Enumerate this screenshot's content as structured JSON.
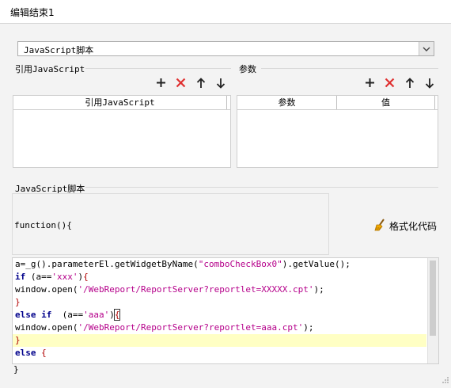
{
  "window": {
    "title": "编辑结束1"
  },
  "script_type": {
    "selected": "JavaScript脚本"
  },
  "ref_section": {
    "label": "引用JavaScript",
    "columns": [
      "引用JavaScript"
    ]
  },
  "param_section": {
    "label": "参数",
    "columns": [
      "参数",
      "值"
    ]
  },
  "script_section": {
    "label": "JavaScript脚本"
  },
  "function_header": "function(){",
  "format_button": {
    "label": "格式化代码"
  },
  "code_lines": [
    "a=_g().parameterEl.getWidgetByName(\"comboCheckBox0\").getValue();",
    "if (a=='xxx'){",
    "window.open('/WebReport/ReportServer?reportlet=XXXXX.cpt');",
    "}",
    "else if  (a=='aaa'){",
    "window.open('/WebReport/ReportServer?reportlet=aaa.cpt');",
    "}",
    "else {"
  ],
  "closing_brace": "}",
  "icons": [
    "add-icon",
    "delete-icon",
    "move-up-icon",
    "move-down-icon",
    "chevron-down-icon",
    "broom-icon"
  ],
  "colors": {
    "delete_red": "#e03030",
    "highlight_line": "#ffffc4",
    "keyword": "#00008b",
    "string": "#b5008a"
  }
}
